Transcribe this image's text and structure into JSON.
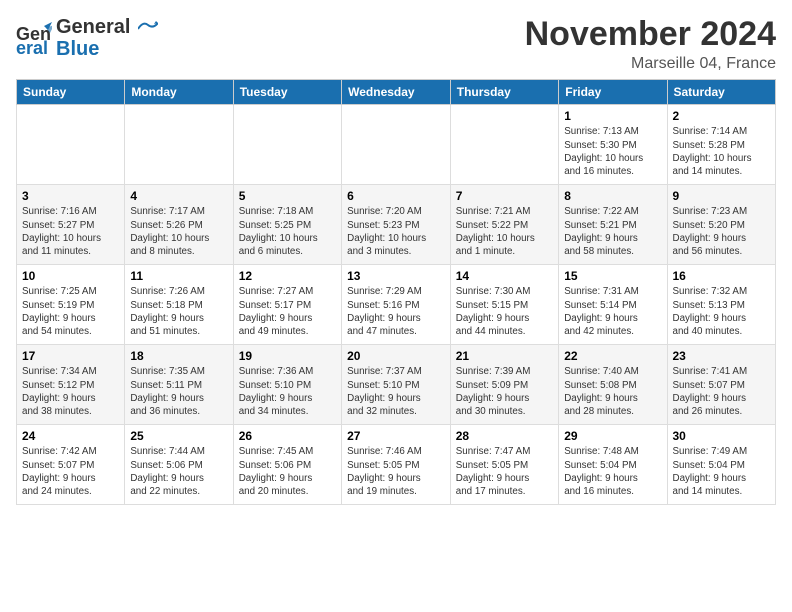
{
  "header": {
    "logo_line1": "General",
    "logo_line2": "Blue",
    "month": "November 2024",
    "location": "Marseille 04, France"
  },
  "days_of_week": [
    "Sunday",
    "Monday",
    "Tuesday",
    "Wednesday",
    "Thursday",
    "Friday",
    "Saturday"
  ],
  "weeks": [
    [
      {
        "day": "",
        "info": ""
      },
      {
        "day": "",
        "info": ""
      },
      {
        "day": "",
        "info": ""
      },
      {
        "day": "",
        "info": ""
      },
      {
        "day": "",
        "info": ""
      },
      {
        "day": "1",
        "info": "Sunrise: 7:13 AM\nSunset: 5:30 PM\nDaylight: 10 hours\nand 16 minutes."
      },
      {
        "day": "2",
        "info": "Sunrise: 7:14 AM\nSunset: 5:28 PM\nDaylight: 10 hours\nand 14 minutes."
      }
    ],
    [
      {
        "day": "3",
        "info": "Sunrise: 7:16 AM\nSunset: 5:27 PM\nDaylight: 10 hours\nand 11 minutes."
      },
      {
        "day": "4",
        "info": "Sunrise: 7:17 AM\nSunset: 5:26 PM\nDaylight: 10 hours\nand 8 minutes."
      },
      {
        "day": "5",
        "info": "Sunrise: 7:18 AM\nSunset: 5:25 PM\nDaylight: 10 hours\nand 6 minutes."
      },
      {
        "day": "6",
        "info": "Sunrise: 7:20 AM\nSunset: 5:23 PM\nDaylight: 10 hours\nand 3 minutes."
      },
      {
        "day": "7",
        "info": "Sunrise: 7:21 AM\nSunset: 5:22 PM\nDaylight: 10 hours\nand 1 minute."
      },
      {
        "day": "8",
        "info": "Sunrise: 7:22 AM\nSunset: 5:21 PM\nDaylight: 9 hours\nand 58 minutes."
      },
      {
        "day": "9",
        "info": "Sunrise: 7:23 AM\nSunset: 5:20 PM\nDaylight: 9 hours\nand 56 minutes."
      }
    ],
    [
      {
        "day": "10",
        "info": "Sunrise: 7:25 AM\nSunset: 5:19 PM\nDaylight: 9 hours\nand 54 minutes."
      },
      {
        "day": "11",
        "info": "Sunrise: 7:26 AM\nSunset: 5:18 PM\nDaylight: 9 hours\nand 51 minutes."
      },
      {
        "day": "12",
        "info": "Sunrise: 7:27 AM\nSunset: 5:17 PM\nDaylight: 9 hours\nand 49 minutes."
      },
      {
        "day": "13",
        "info": "Sunrise: 7:29 AM\nSunset: 5:16 PM\nDaylight: 9 hours\nand 47 minutes."
      },
      {
        "day": "14",
        "info": "Sunrise: 7:30 AM\nSunset: 5:15 PM\nDaylight: 9 hours\nand 44 minutes."
      },
      {
        "day": "15",
        "info": "Sunrise: 7:31 AM\nSunset: 5:14 PM\nDaylight: 9 hours\nand 42 minutes."
      },
      {
        "day": "16",
        "info": "Sunrise: 7:32 AM\nSunset: 5:13 PM\nDaylight: 9 hours\nand 40 minutes."
      }
    ],
    [
      {
        "day": "17",
        "info": "Sunrise: 7:34 AM\nSunset: 5:12 PM\nDaylight: 9 hours\nand 38 minutes."
      },
      {
        "day": "18",
        "info": "Sunrise: 7:35 AM\nSunset: 5:11 PM\nDaylight: 9 hours\nand 36 minutes."
      },
      {
        "day": "19",
        "info": "Sunrise: 7:36 AM\nSunset: 5:10 PM\nDaylight: 9 hours\nand 34 minutes."
      },
      {
        "day": "20",
        "info": "Sunrise: 7:37 AM\nSunset: 5:10 PM\nDaylight: 9 hours\nand 32 minutes."
      },
      {
        "day": "21",
        "info": "Sunrise: 7:39 AM\nSunset: 5:09 PM\nDaylight: 9 hours\nand 30 minutes."
      },
      {
        "day": "22",
        "info": "Sunrise: 7:40 AM\nSunset: 5:08 PM\nDaylight: 9 hours\nand 28 minutes."
      },
      {
        "day": "23",
        "info": "Sunrise: 7:41 AM\nSunset: 5:07 PM\nDaylight: 9 hours\nand 26 minutes."
      }
    ],
    [
      {
        "day": "24",
        "info": "Sunrise: 7:42 AM\nSunset: 5:07 PM\nDaylight: 9 hours\nand 24 minutes."
      },
      {
        "day": "25",
        "info": "Sunrise: 7:44 AM\nSunset: 5:06 PM\nDaylight: 9 hours\nand 22 minutes."
      },
      {
        "day": "26",
        "info": "Sunrise: 7:45 AM\nSunset: 5:06 PM\nDaylight: 9 hours\nand 20 minutes."
      },
      {
        "day": "27",
        "info": "Sunrise: 7:46 AM\nSunset: 5:05 PM\nDaylight: 9 hours\nand 19 minutes."
      },
      {
        "day": "28",
        "info": "Sunrise: 7:47 AM\nSunset: 5:05 PM\nDaylight: 9 hours\nand 17 minutes."
      },
      {
        "day": "29",
        "info": "Sunrise: 7:48 AM\nSunset: 5:04 PM\nDaylight: 9 hours\nand 16 minutes."
      },
      {
        "day": "30",
        "info": "Sunrise: 7:49 AM\nSunset: 5:04 PM\nDaylight: 9 hours\nand 14 minutes."
      }
    ]
  ]
}
